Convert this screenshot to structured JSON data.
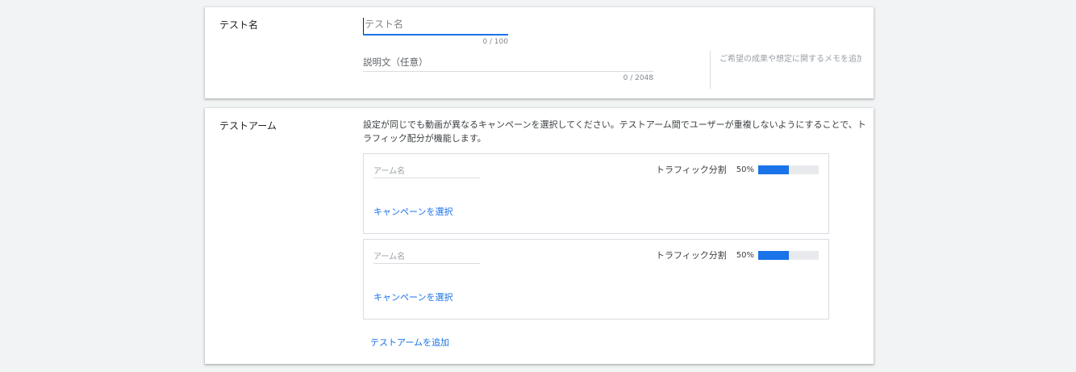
{
  "test_name_section": {
    "label": "テスト名",
    "name_placeholder": "テスト名",
    "name_counter": "0 / 100",
    "description_placeholder": "説明文（任意）",
    "description_counter": "0 / 2048",
    "memo_hint": "ご希望の成果や想定に関するメモを追加"
  },
  "test_arms_section": {
    "label": "テストアーム",
    "description": "設定が同じでも動画が異なるキャンペーンを選択してください。テストアーム間でユーザーが重複しないようにすることで、トラフィック配分が機能します。",
    "arms": [
      {
        "name_placeholder": "アーム名",
        "traffic_label": "トラフィック分割",
        "traffic_percent_text": "50%",
        "traffic_fraction": 0.5,
        "campaign_link": "キャンペーンを選択"
      },
      {
        "name_placeholder": "アーム名",
        "traffic_label": "トラフィック分割",
        "traffic_percent_text": "50%",
        "traffic_fraction": 0.5,
        "campaign_link": "キャンペーンを選択"
      }
    ],
    "add_arm_label": "テストアームを追加"
  },
  "colors": {
    "accent": "#1a73e8",
    "background": "#f1f3f4",
    "divider": "#dadce0"
  }
}
